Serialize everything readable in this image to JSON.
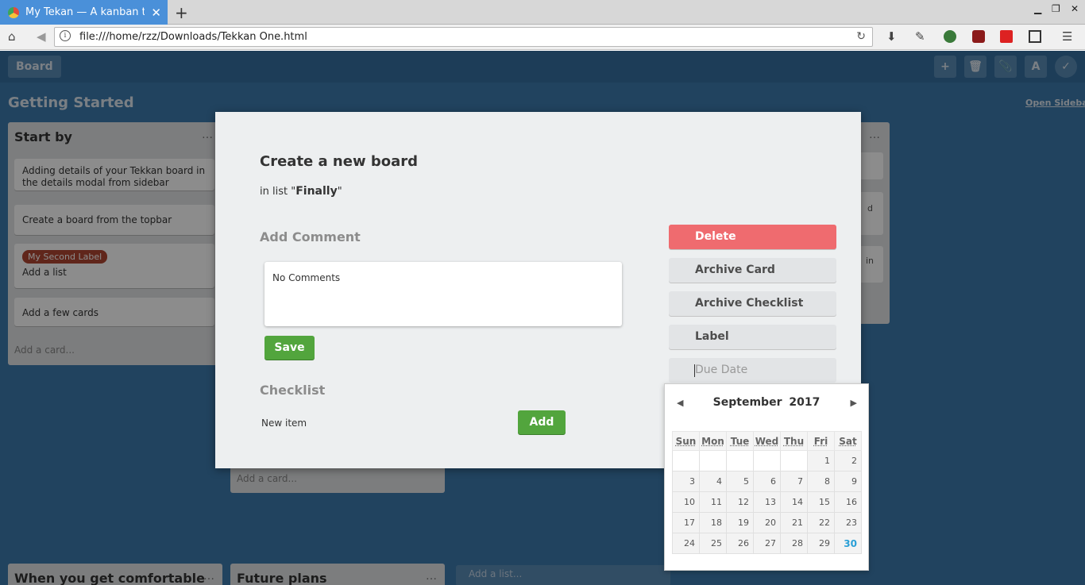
{
  "browser": {
    "tab_title": "My Tekan — A kanban t",
    "url": "file:///home/rzz/Downloads/Tekkan One.html"
  },
  "topbar": {
    "board_button": "Board",
    "buttons": [
      "+",
      "🗑",
      "📎",
      "A",
      "✓"
    ]
  },
  "board": {
    "title": "Getting Started",
    "open_sidebar": "Open Sidebar",
    "lists": [
      {
        "name": "Start by",
        "cards": [
          "Adding details of your Tekkan board in the details modal from sidebar",
          "Create a board from the topbar",
          "Add a list",
          "Add a few cards"
        ],
        "card3_label": "My Second Label",
        "add_card": "Add a card..."
      }
    ],
    "partial": {
      "right_frag_1": "d",
      "right_frag_2": "in",
      "add_card_2": "Add a card...",
      "list_when": "When you get comfortable",
      "list_future": "Future plans",
      "add_list": "Add a list..."
    }
  },
  "modal": {
    "title": "Create a new board",
    "in_list_prefix": "in list \"",
    "list_name": "Finally",
    "in_list_suffix": "\"",
    "add_comment_heading": "Add Comment",
    "comment_text": "No Comments",
    "save": "Save",
    "checklist_heading": "Checklist",
    "new_item": "New item",
    "add": "Add",
    "actions": {
      "delete": "Delete",
      "archive_card": "Archive Card",
      "archive_checklist": "Archive Checklist",
      "label": "Label",
      "due_date_placeholder": "Due Date"
    }
  },
  "calendar": {
    "month": "September",
    "year": "2017",
    "weekdays": [
      "Sun",
      "Mon",
      "Tue",
      "Wed",
      "Thu",
      "Fri",
      "Sat"
    ],
    "weeks": [
      [
        "",
        "",
        "",
        "",
        "",
        "1",
        "2"
      ],
      [
        "3",
        "4",
        "5",
        "6",
        "7",
        "8",
        "9"
      ],
      [
        "10",
        "11",
        "12",
        "13",
        "14",
        "15",
        "16"
      ],
      [
        "17",
        "18",
        "19",
        "20",
        "21",
        "22",
        "23"
      ],
      [
        "24",
        "25",
        "26",
        "27",
        "28",
        "29",
        "30"
      ]
    ],
    "today": "30"
  }
}
